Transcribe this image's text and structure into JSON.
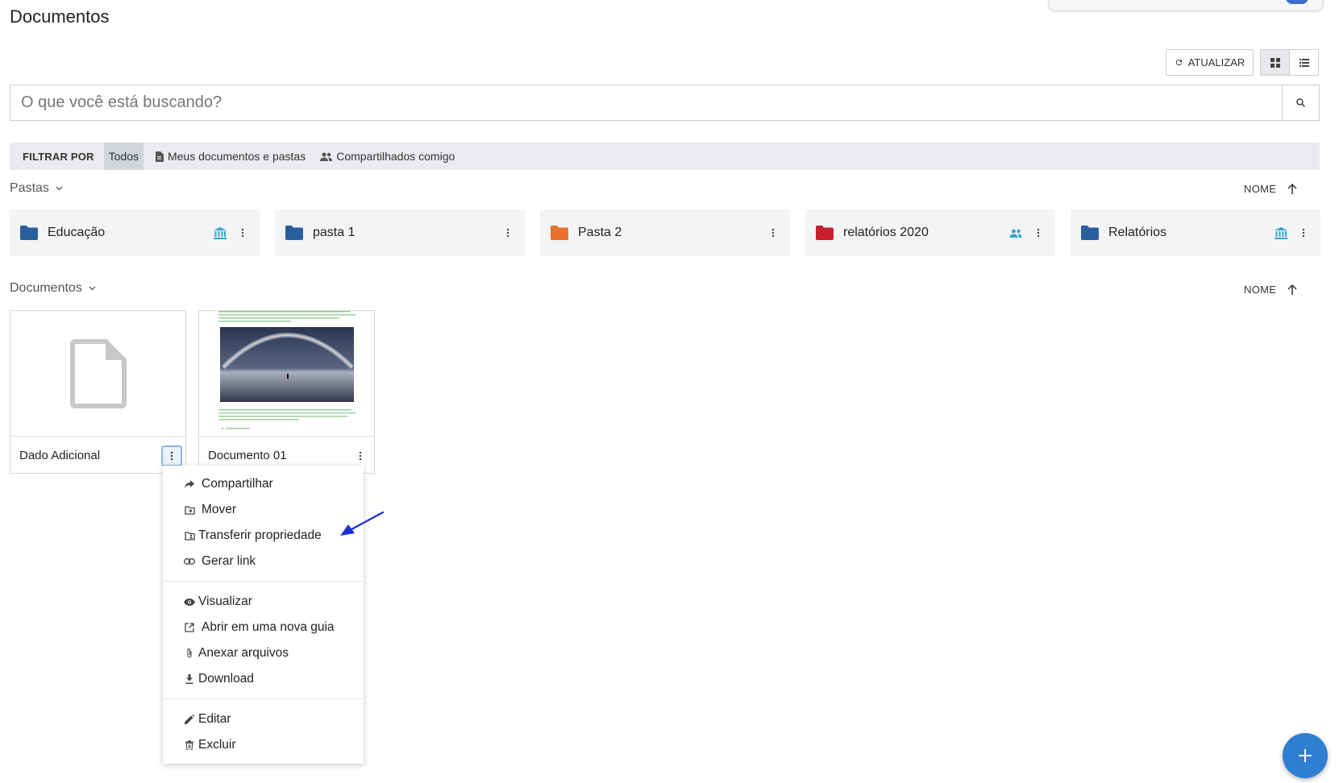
{
  "page": {
    "title": "Documentos"
  },
  "toolbar": {
    "refresh_label": "ATUALIZAR",
    "view_grid": "grid-view-icon",
    "view_list": "list-view-icon"
  },
  "search": {
    "placeholder": "O que você está buscando?",
    "value": ""
  },
  "filters": {
    "label": "FILTRAR POR",
    "options": [
      "Todos",
      "Meus documentos e pastas",
      "Compartilhados comigo"
    ],
    "active": "Todos"
  },
  "folders_section": {
    "title": "Pastas",
    "sort_label": "NOME",
    "sort_direction": "ascending"
  },
  "folders": [
    {
      "name": "Educação",
      "color": "#2a5f9e",
      "badge": "institution-icon"
    },
    {
      "name": "pasta 1",
      "color": "#2a5f9e",
      "badge": ""
    },
    {
      "name": "Pasta 2",
      "color": "#e8712b",
      "badge": ""
    },
    {
      "name": "relatórios 2020",
      "color": "#c8202f",
      "badge": "people-icon"
    },
    {
      "name": "Relatórios",
      "color": "#2a5f9e",
      "badge": "institution-icon"
    }
  ],
  "documents_section": {
    "title": "Documentos",
    "sort_label": "NOME",
    "sort_direction": "ascending"
  },
  "documents": [
    {
      "name": "Dado Adicional",
      "thumbnail": "file-icon"
    },
    {
      "name": "Documento 01",
      "thumbnail": "document-preview"
    }
  ],
  "context_menu": {
    "groups": [
      [
        "Compartilhar",
        "Mover",
        "Transferir propriedade",
        "Gerar link"
      ],
      [
        "Visualizar",
        "Abrir em uma nova guia",
        "Anexar arquivos",
        "Download"
      ],
      [
        "Editar",
        "Excluir"
      ]
    ]
  },
  "colors": {
    "accent": "#2e7fd1",
    "badge_icon": "#3aa3c9",
    "annotation_arrow": "#1a2fd6"
  }
}
